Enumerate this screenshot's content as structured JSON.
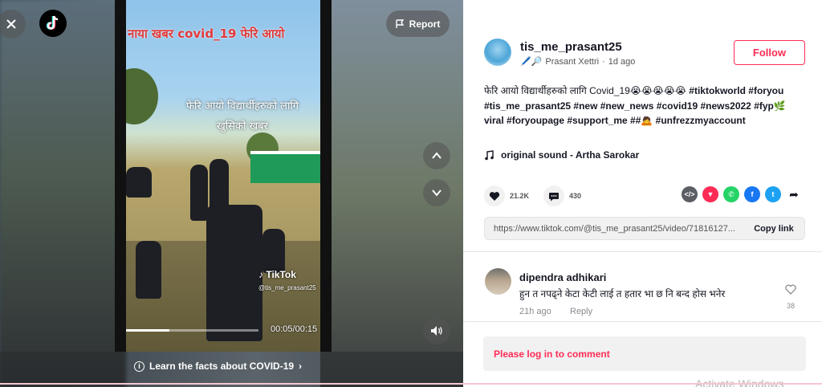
{
  "video": {
    "overlay_title": "नाया खबर covid_19 फेरि आयो",
    "overlay_subtitle": "फेरि आयो विद्यार्थीहरुको लागि खुसिको खबर",
    "watermark_brand": "TikTok",
    "watermark_user": "@tis_me_prasant25",
    "time": "00:05/00:15",
    "progress_percent": 33,
    "covid_banner": "Learn the facts about COVID-19",
    "report_label": "Report"
  },
  "author": {
    "username": "tis_me_prasant25",
    "display_name": "Prasant Xettri",
    "posted": "1d ago",
    "follow_label": "Follow"
  },
  "caption": {
    "plain": "फेरि आयो विद्यार्थीहरुको लागि Covid_19😭😭😭😭😭 ",
    "tags": "#tiktokworld #foryou #tis_me_prasant25 #new #new_news #covid19 #news2022 #fyp🌿viral #foryoupage #support_me ##🙇 #unfrezzmyaccount"
  },
  "sound": "original sound - Artha Sarokar",
  "stats": {
    "likes": "21.2K",
    "comments": "430"
  },
  "share_icons": [
    "embed-icon",
    "send-icon",
    "whatsapp-icon",
    "facebook-icon",
    "twitter-icon",
    "share-arrow-icon"
  ],
  "link": {
    "url": "https://www.tiktok.com/@tis_me_prasant25/video/71816127...",
    "copy_label": "Copy link"
  },
  "comments": [
    {
      "user": "dipendra adhikari",
      "text": "हुन त नपढ्ने केटा केटी लाई त हतार भा छ नि बन्द होस भनेर",
      "time": "21h ago",
      "reply_label": "Reply",
      "likes": "38"
    }
  ],
  "login_prompt": "Please log in to comment",
  "system_watermark": "Activate Windows",
  "colors": {
    "accent": "#fe2c55",
    "text": "#161823",
    "muted": "#8a8b91"
  }
}
